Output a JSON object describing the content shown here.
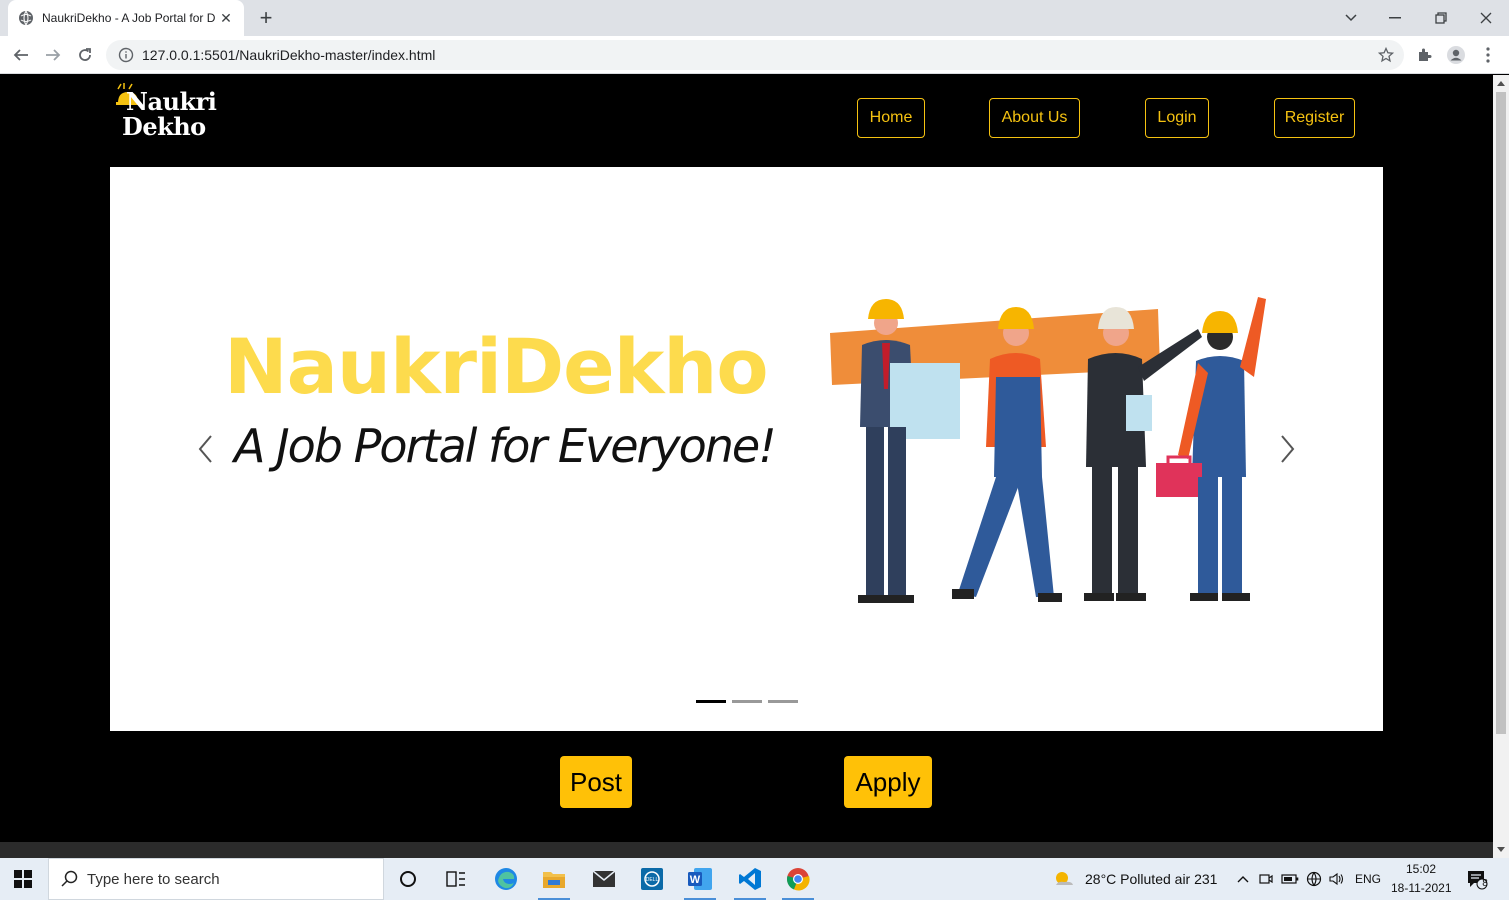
{
  "browser": {
    "tab_title": "NaukriDekho - A Job Portal for D",
    "url": "127.0.0.1:5501/NaukriDekho-master/index.html"
  },
  "site": {
    "logo": {
      "line1": "Naukri",
      "line2": "Dekho"
    },
    "nav": {
      "home": "Home",
      "about": "About Us",
      "login": "Login",
      "register": "Register"
    },
    "hero": {
      "title": "NaukriDekho",
      "subtitle": "A Job Portal for Everyone!",
      "slides_total": 3,
      "active_slide": 1
    },
    "actions": {
      "post": "Post",
      "apply": "Apply"
    },
    "colors": {
      "accent": "#ffc107",
      "hero_title": "#fddb4d",
      "nav_border": "#f5c211"
    }
  },
  "taskbar": {
    "search_placeholder": "Type here to search",
    "weather": "28°C  Polluted air 231",
    "language": "ENG",
    "time": "15:02",
    "date": "18-11-2021",
    "notification_count": "8"
  }
}
